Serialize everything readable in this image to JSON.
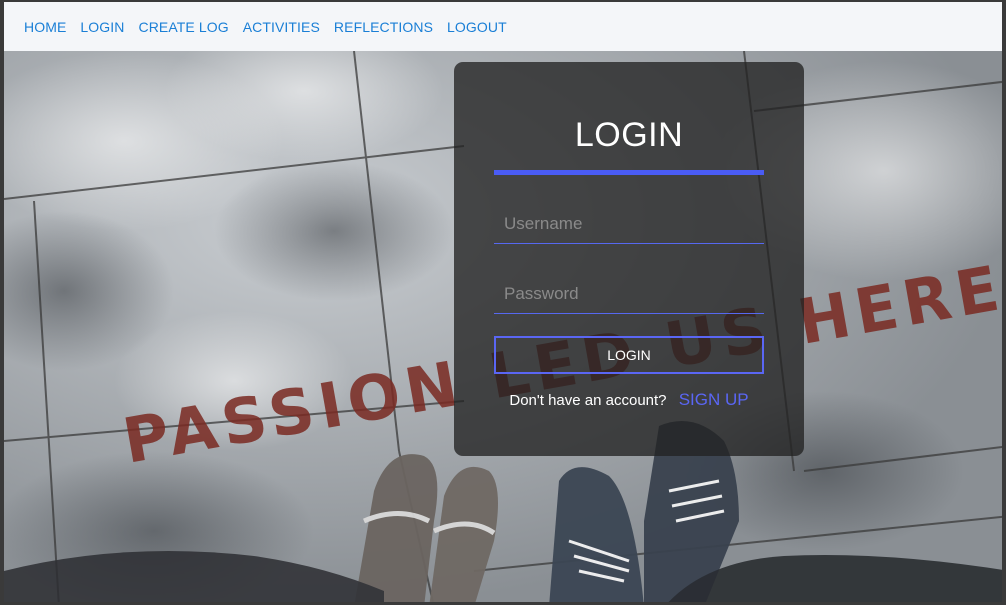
{
  "nav": {
    "items": [
      {
        "label": "HOME"
      },
      {
        "label": "LOGIN"
      },
      {
        "label": "CREATE LOG"
      },
      {
        "label": "ACTIVITIES"
      },
      {
        "label": "REFLECTIONS"
      },
      {
        "label": "LOGOUT"
      }
    ]
  },
  "hero": {
    "background_text": "PASSION LED US HERE"
  },
  "login": {
    "title": "LOGIN",
    "username_placeholder": "Username",
    "username_value": "",
    "password_placeholder": "Password",
    "password_value": "",
    "button_label": "LOGIN",
    "signup_prompt": "Don't have an account?",
    "signup_link": "SIGN UP"
  },
  "colors": {
    "nav_link": "#1a7fd6",
    "nav_bg": "#f4f6f9",
    "accent": "#4a5cf5",
    "card_bg": "#222222"
  }
}
